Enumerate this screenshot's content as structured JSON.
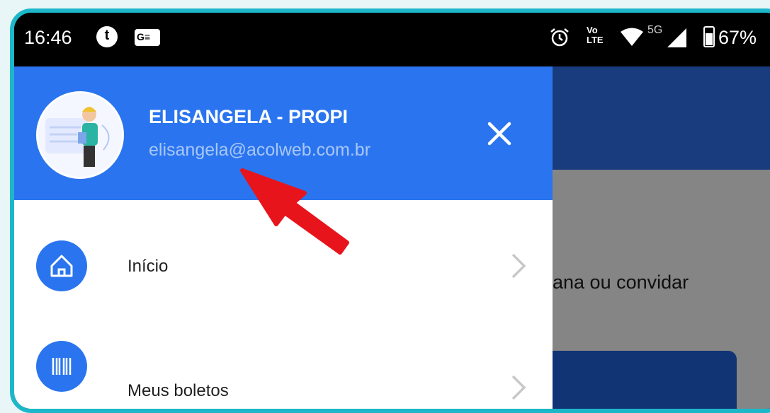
{
  "status_bar": {
    "time": "16:46",
    "notification_icon_letter": "t",
    "gboard_icon_text": "G≡",
    "volte_label": "Vo∕\nLTE",
    "network_label": "5G",
    "battery_percent": "67%",
    "icons": [
      "alarm-icon",
      "volte-icon",
      "wifi-icon",
      "signal-icon",
      "battery-icon"
    ]
  },
  "drawer": {
    "user_name": "ELISANGELA - PROPI",
    "user_email": "elisangela@acolweb.com.br",
    "close_icon": "close-icon",
    "menu": [
      {
        "label": "Início",
        "icon": "home-icon"
      },
      {
        "label": "Meus boletos",
        "icon": "barcode-icon"
      }
    ]
  },
  "background_app": {
    "partial_text": "ana ou convidar"
  },
  "colors": {
    "drawer_header": "#2a75ef",
    "frame_border": "#1cb7c9",
    "annotation_arrow": "#e8141b"
  }
}
